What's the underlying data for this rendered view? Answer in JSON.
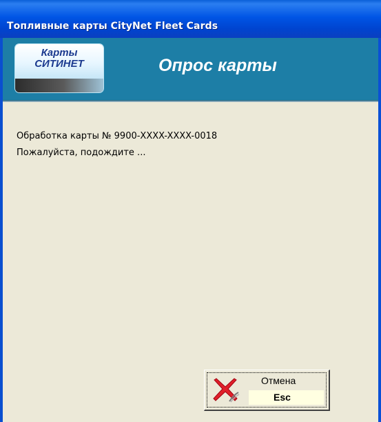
{
  "window": {
    "title": "Топливные карты CityNet Fleet Cards"
  },
  "header": {
    "logo_line1": "Карты",
    "logo_line2": "СИТИНЕТ",
    "title": "Опрос карты"
  },
  "body": {
    "message_line1": "Обработка карты № 9900-XXXX-XXXX-0018",
    "message_line2": "Пожалуйста, подождите ..."
  },
  "cancel_button": {
    "label": "Отмена",
    "shortcut": "Esc",
    "icon": "red-x-icon"
  },
  "colors": {
    "titlebar": "#0055e5",
    "header": "#1d7ea6",
    "background": "#ece9d8",
    "logo_text": "#1b3a8f",
    "cancel_icon": "#e0202a"
  }
}
